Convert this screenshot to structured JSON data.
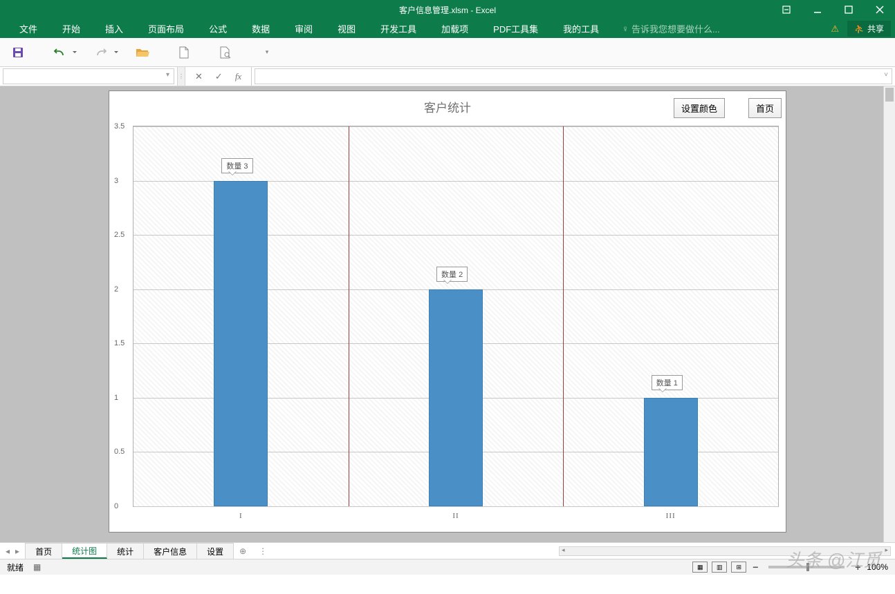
{
  "titlebar": {
    "title": "客户信息管理.xlsm - Excel"
  },
  "ribbon": {
    "tabs": [
      "文件",
      "开始",
      "插入",
      "页面布局",
      "公式",
      "数据",
      "审阅",
      "视图",
      "开发工具",
      "加载项",
      "PDF工具集",
      "我的工具"
    ],
    "tellme": "告诉我您想要做什么...",
    "share": "共享"
  },
  "chart": {
    "title": "客户统计",
    "btn_color": "设置颜色",
    "btn_home": "首页"
  },
  "chart_data": {
    "type": "bar",
    "categories": [
      "I",
      "II",
      "III"
    ],
    "series": [
      {
        "name": "数量",
        "values": [
          3,
          2,
          1
        ]
      }
    ],
    "data_labels": [
      "数量 3",
      "数量 2",
      "数量 1"
    ],
    "title": "客户统计",
    "xlabel": "",
    "ylabel": "",
    "ylim": [
      0,
      3.5
    ],
    "yticks": [
      0,
      0.5,
      1,
      1.5,
      2,
      2.5,
      3,
      3.5
    ]
  },
  "sheets": {
    "tabs": [
      "首页",
      "统计图",
      "统计",
      "客户信息",
      "设置"
    ],
    "active": 1
  },
  "status": {
    "ready": "就绪",
    "zoom": "100%"
  },
  "watermark": "头条 @江觅"
}
